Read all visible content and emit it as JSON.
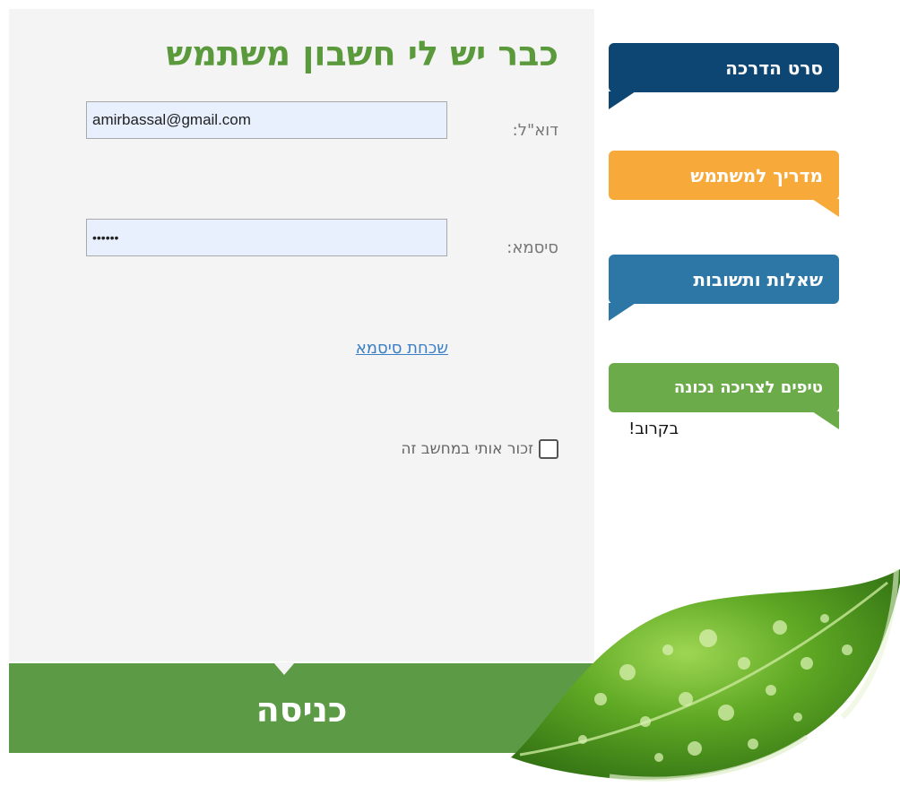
{
  "login": {
    "title": "כבר יש לי חשבון משתמש",
    "email_label": "דוא\"ל:",
    "email_value": "amirbassal@gmail.com",
    "password_label": "סיסמא:",
    "password_value": "••••••",
    "forgot_link": "שכחת סיסמא",
    "remember_label": "זכור אותי במחשב זה",
    "remember_checked": false,
    "submit_label": "כניסה"
  },
  "side_menu": {
    "items": [
      {
        "label": "סרט הדרכה",
        "color": "#0e4673"
      },
      {
        "label": "מדריך למשתמש",
        "color": "#f7a93a"
      },
      {
        "label": "שאלות ותשובות",
        "color": "#2d77a7"
      },
      {
        "label": "טיפים לצריכה נכונה",
        "color": "#6bab49"
      }
    ],
    "soon_text": "בקרוב!"
  },
  "decoration": {
    "leaf": "leaf-with-water-drops-image",
    "leaf_color": "#4f9a1f"
  }
}
